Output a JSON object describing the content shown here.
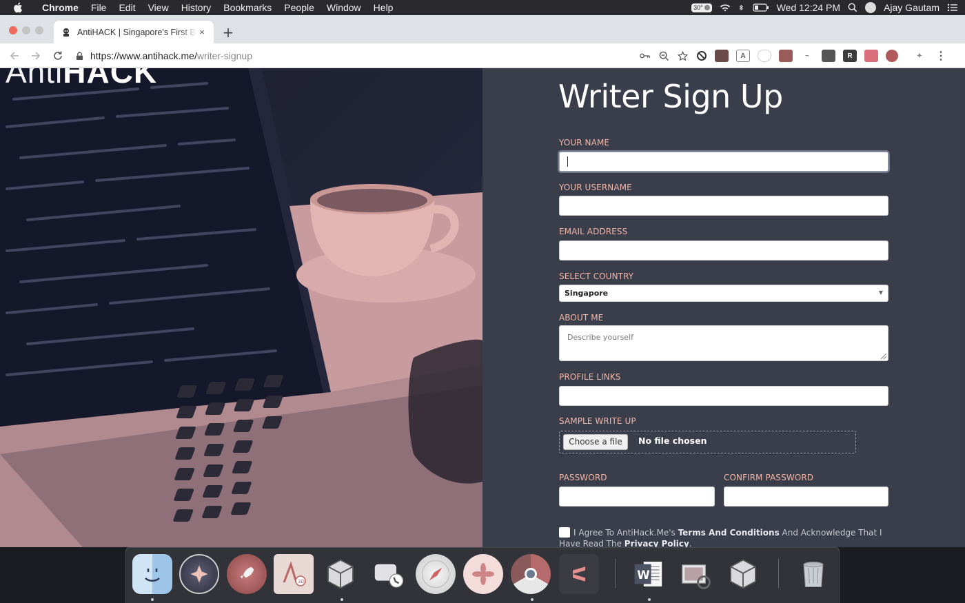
{
  "menubar": {
    "app_name": "Chrome",
    "menus": [
      "File",
      "Edit",
      "View",
      "History",
      "Bookmarks",
      "People",
      "Window",
      "Help"
    ],
    "temperature": "30°",
    "clock": "Wed 12:24 PM",
    "user": "Ajay Gautam"
  },
  "browser": {
    "tab_title": "AntiHACK | Singapore's First Bug Bounty",
    "tab_close": "×",
    "new_tab": "+",
    "url_host": "https://www.antihack.me/",
    "url_path": "writer-signup"
  },
  "hero": {
    "logo_anti": "Anti",
    "logo_hack": "HACK"
  },
  "form": {
    "title": "Writer Sign Up",
    "name_label": "YOUR NAME",
    "name_value": "",
    "username_label": "YOUR USERNAME",
    "email_label": "EMAIL ADDRESS",
    "country_label": "SELECT COUNTRY",
    "country_value": "Singapore",
    "about_label": "ABOUT ME",
    "about_placeholder": "Describe yourself",
    "links_label": "PROFILE LINKS",
    "sample_label": "SAMPLE WRITE UP",
    "choose_file_label": "Choose a file",
    "no_file_text": "No file chosen",
    "password_label": "PASSWORD",
    "confirm_password_label": "CONFIRM PASSWORD",
    "agree_prefix": "I Agree To AntiHack.Me's ",
    "terms_link": "Terms And Conditions",
    "agree_middle": " And Acknowledge That I Have Read The ",
    "privacy_link": "Privacy Policy",
    "agree_suffix": "."
  },
  "dock": {
    "apps": [
      "finder-icon",
      "siri-icon",
      "launchpad-icon",
      "maps-icon",
      "virtualbox-icon",
      "facetime-icon",
      "safari-icon",
      "photos-icon",
      "chrome-icon",
      "sublime-icon",
      "word-icon",
      "preview-icon",
      "virtualbox-vm-icon",
      "trash-icon"
    ]
  },
  "colors": {
    "panel_bg": "#3a3d4a",
    "label": "#f2b6a8",
    "hero_tint": "#d59a9a"
  }
}
